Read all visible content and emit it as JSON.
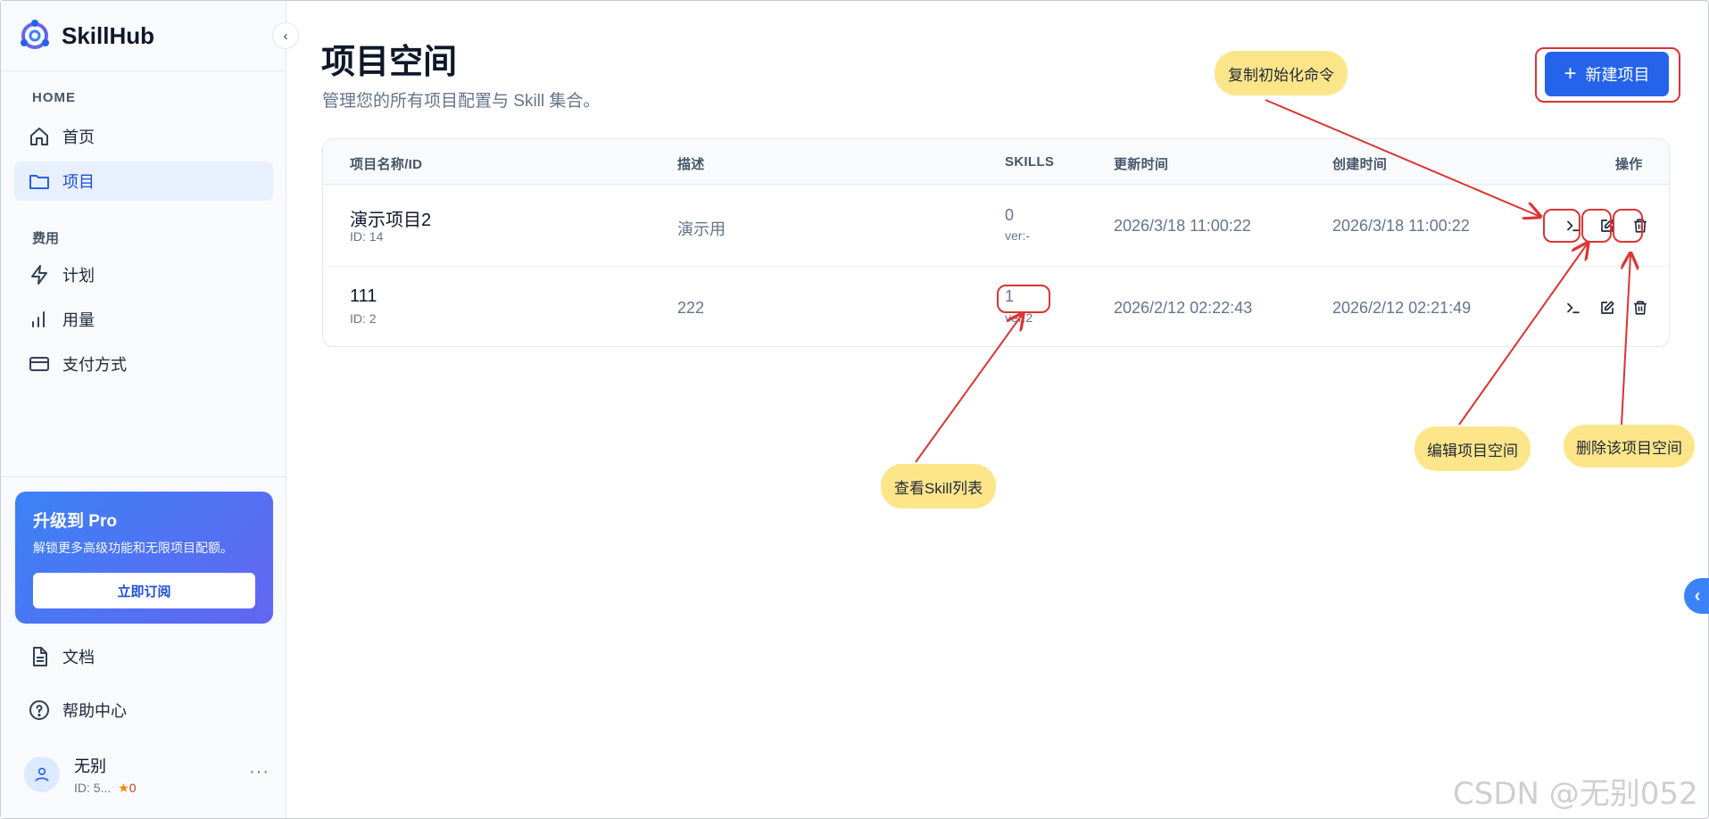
{
  "app": {
    "name": "SkillHub",
    "brand_color": "#2563eb"
  },
  "sidebar": {
    "collapse_icon": "chevron-left-icon",
    "section_home": "HOME",
    "nav_home": "首页",
    "nav_projects": "项目",
    "section_billing": "费用",
    "nav_plan": "计划",
    "nav_usage": "用量",
    "nav_payment": "支付方式",
    "nav_docs": "文档",
    "nav_help": "帮助中心",
    "pro": {
      "title": "升级到 Pro",
      "description": "解锁更多高级功能和无限项目配额。",
      "button": "立即订阅"
    },
    "user": {
      "name": "无别",
      "id": "ID: 5...",
      "points": "0"
    }
  },
  "main": {
    "title": "项目空间",
    "subtitle": "管理您的所有项目配置与 Skill 集合。",
    "new_button": "新建项目",
    "table": {
      "headers": {
        "name": "项目名称/ID",
        "description": "描述",
        "skills": "SKILLS",
        "updated": "更新时间",
        "created": "创建时间",
        "actions": "操作"
      },
      "rows": [
        {
          "name": "演示项目2",
          "id": "ID: 14",
          "description": "演示用",
          "skills": "0",
          "version": "ver:-",
          "updated": "2026/3/18 11:00:22",
          "created": "2026/3/18 11:00:22"
        },
        {
          "name": "111",
          "id": "ID: 2",
          "description": "222",
          "skills": "1",
          "version": "ver:2",
          "updated": "2026/2/12 02:22:43",
          "created": "2026/2/12 02:21:49"
        }
      ]
    }
  },
  "annotations": {
    "copy_init": "复制初始化命令",
    "view_skills": "查看Skill列表",
    "edit_project": "编辑项目空间",
    "delete_project": "删除该项目空间"
  },
  "watermark": "CSDN @无别052"
}
